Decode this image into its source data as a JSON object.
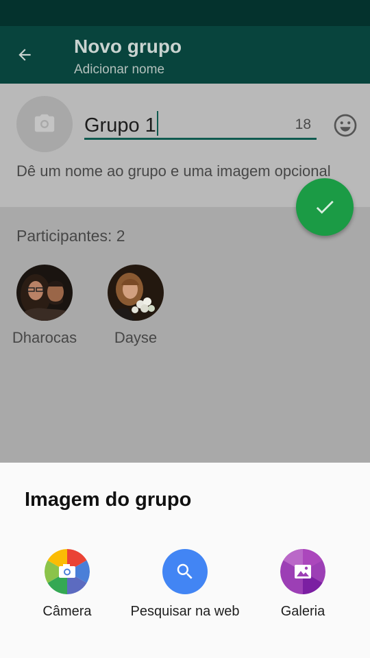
{
  "header": {
    "title": "Novo grupo",
    "subtitle": "Adicionar nome",
    "back_icon": "arrow-back-icon"
  },
  "group_form": {
    "photo_icon": "camera-icon",
    "name_value": "Grupo 1",
    "char_counter": "18",
    "emoji_icon": "emoji-icon",
    "hint": "Dê um nome ao grupo e uma imagem opcional",
    "confirm_icon": "check-icon"
  },
  "participants": {
    "label": "Participantes: 2",
    "items": [
      {
        "name": "Dharocas"
      },
      {
        "name": "Dayse"
      }
    ]
  },
  "sheet": {
    "title": "Imagem do grupo",
    "options": [
      {
        "label": "Câmera",
        "icon": "camera-app-icon"
      },
      {
        "label": "Pesquisar na web",
        "icon": "search-icon"
      },
      {
        "label": "Galeria",
        "icon": "gallery-icon"
      }
    ]
  },
  "colors": {
    "app_bar": "#08443d",
    "accent": "#0f5a4f",
    "fab": "#1b9b45",
    "search": "#4285f4",
    "gallery": "#9c3fb5"
  }
}
